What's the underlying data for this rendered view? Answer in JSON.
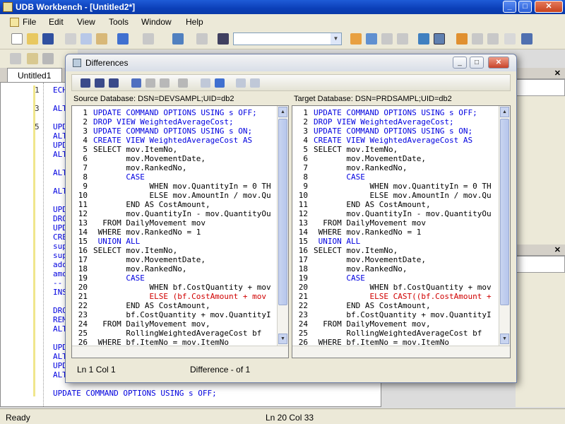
{
  "window": {
    "title": "UDB Workbench - [Untitled2*]"
  },
  "menu": [
    "File",
    "Edit",
    "View",
    "Tools",
    "Window",
    "Help"
  ],
  "editor_tab": "Untitled1",
  "editor_lines": [
    {
      "num": "1",
      "text": "ECHO"
    },
    {
      "num": "",
      "text": ""
    },
    {
      "num": "3",
      "text": "ALTER"
    },
    {
      "num": "",
      "text": ""
    },
    {
      "num": "5",
      "text": "UPDA"
    },
    {
      "num": "",
      "text": "ALTE"
    },
    {
      "num": "",
      "text": "UPDA"
    },
    {
      "num": "",
      "text": "ALTE"
    },
    {
      "num": "",
      "text": ""
    },
    {
      "num": "",
      "text": "ALTE"
    },
    {
      "num": "",
      "text": ""
    },
    {
      "num": "",
      "text": "ALTE"
    },
    {
      "num": "",
      "text": ""
    },
    {
      "num": "",
      "text": "UPDA"
    },
    {
      "num": "",
      "text": "DROP"
    },
    {
      "num": "",
      "text": "UPDA"
    },
    {
      "num": "",
      "text": "CREA"
    },
    {
      "num": "",
      "text": "supe"
    },
    {
      "num": "",
      "text": "supe"
    },
    {
      "num": "",
      "text": "adde"
    },
    {
      "num": "",
      "text": "amou"
    },
    {
      "num": "",
      "text": "--"
    },
    {
      "num": "",
      "text": "INSE"
    },
    {
      "num": "",
      "text": ""
    },
    {
      "num": "",
      "text": "DROP"
    },
    {
      "num": "",
      "text": "REMO"
    },
    {
      "num": "",
      "text": "ALTE"
    },
    {
      "num": "",
      "text": ""
    },
    {
      "num": "",
      "text": "UPDA"
    },
    {
      "num": "",
      "text": "ALTE"
    },
    {
      "num": "",
      "text": "UPDA"
    },
    {
      "num": "",
      "text": "ALTE"
    },
    {
      "num": "",
      "text": ""
    },
    {
      "num": "",
      "text": "UPDATE COMMAND OPTIONS USING s OFF;"
    }
  ],
  "status": {
    "left": "Ready",
    "position": "Ln 20  Col 33"
  },
  "dialog": {
    "title": "Differences",
    "source_header": "Source Database: DSN=DEVSAMPL;UID=db2",
    "target_header": "Target Database: DSN=PRDSAMPL;UID=db2",
    "status_pos": "Ln 1  Col 1",
    "status_diff": "Difference - of 1",
    "source_lines": [
      {
        "n": "1",
        "t": "UPDATE COMMAND OPTIONS USING s OFF;",
        "c": "kw"
      },
      {
        "n": "2",
        "t": "DROP VIEW WeightedAverageCost;",
        "c": "kw"
      },
      {
        "n": "3",
        "t": "UPDATE COMMAND OPTIONS USING s ON;",
        "c": "kw"
      },
      {
        "n": "4",
        "t": "CREATE VIEW WeightedAverageCost AS",
        "c": "kw"
      },
      {
        "n": "5",
        "t": "SELECT mov.ItemNo,",
        "c": ""
      },
      {
        "n": "6",
        "t": "       mov.MovementDate,",
        "c": ""
      },
      {
        "n": "7",
        "t": "       mov.RankedNo,",
        "c": ""
      },
      {
        "n": "8",
        "t": "       CASE",
        "c": "kw"
      },
      {
        "n": "9",
        "t": "            WHEN mov.QuantityIn = 0 TH",
        "c": ""
      },
      {
        "n": "10",
        "t": "            ELSE mov.AmountIn / mov.Qu",
        "c": ""
      },
      {
        "n": "11",
        "t": "       END AS CostAmount,",
        "c": ""
      },
      {
        "n": "12",
        "t": "       mov.QuantityIn - mov.QuantityOu",
        "c": ""
      },
      {
        "n": "13",
        "t": "  FROM DailyMovement mov",
        "c": ""
      },
      {
        "n": "14",
        "t": " WHERE mov.RankedNo = 1",
        "c": ""
      },
      {
        "n": "15",
        "t": " UNION ALL",
        "c": "kw"
      },
      {
        "n": "16",
        "t": "SELECT mov.ItemNo,",
        "c": ""
      },
      {
        "n": "17",
        "t": "       mov.MovementDate,",
        "c": ""
      },
      {
        "n": "18",
        "t": "       mov.RankedNo,",
        "c": ""
      },
      {
        "n": "19",
        "t": "       CASE",
        "c": "kw"
      },
      {
        "n": "20",
        "t": "            WHEN bf.CostQuantity + mov",
        "c": ""
      },
      {
        "n": "21",
        "t": "            ELSE (bf.CostAmount + mov",
        "c": "red"
      },
      {
        "n": "22",
        "t": "       END AS CostAmount,",
        "c": ""
      },
      {
        "n": "23",
        "t": "       bf.CostQuantity + mov.QuantityI",
        "c": ""
      },
      {
        "n": "24",
        "t": "  FROM DailyMovement mov,",
        "c": ""
      },
      {
        "n": "25",
        "t": "       RollingWeightedAverageCost bf",
        "c": ""
      },
      {
        "n": "26",
        "t": " WHERE bf.ItemNo = mov.ItemNo",
        "c": ""
      }
    ],
    "target_lines": [
      {
        "n": "1",
        "t": "UPDATE COMMAND OPTIONS USING s OFF;",
        "c": "kw"
      },
      {
        "n": "2",
        "t": "DROP VIEW WeightedAverageCost;",
        "c": "kw"
      },
      {
        "n": "3",
        "t": "UPDATE COMMAND OPTIONS USING s ON;",
        "c": "kw"
      },
      {
        "n": "4",
        "t": "CREATE VIEW WeightedAverageCost AS",
        "c": "kw"
      },
      {
        "n": "5",
        "t": "SELECT mov.ItemNo,",
        "c": ""
      },
      {
        "n": "6",
        "t": "       mov.MovementDate,",
        "c": ""
      },
      {
        "n": "7",
        "t": "       mov.RankedNo,",
        "c": ""
      },
      {
        "n": "8",
        "t": "       CASE",
        "c": "kw"
      },
      {
        "n": "9",
        "t": "            WHEN mov.QuantityIn = 0 TH",
        "c": ""
      },
      {
        "n": "10",
        "t": "            ELSE mov.AmountIn / mov.Qu",
        "c": ""
      },
      {
        "n": "11",
        "t": "       END AS CostAmount,",
        "c": ""
      },
      {
        "n": "12",
        "t": "       mov.QuantityIn - mov.QuantityOu",
        "c": ""
      },
      {
        "n": "13",
        "t": "  FROM DailyMovement mov",
        "c": ""
      },
      {
        "n": "14",
        "t": " WHERE mov.RankedNo = 1",
        "c": ""
      },
      {
        "n": "15",
        "t": " UNION ALL",
        "c": "kw"
      },
      {
        "n": "16",
        "t": "SELECT mov.ItemNo,",
        "c": ""
      },
      {
        "n": "17",
        "t": "       mov.MovementDate,",
        "c": ""
      },
      {
        "n": "18",
        "t": "       mov.RankedNo,",
        "c": ""
      },
      {
        "n": "19",
        "t": "       CASE",
        "c": "kw"
      },
      {
        "n": "20",
        "t": "            WHEN bf.CostQuantity + mov",
        "c": ""
      },
      {
        "n": "21",
        "t": "            ELSE CAST((bf.CostAmount +",
        "c": "red"
      },
      {
        "n": "22",
        "t": "       END AS CostAmount,",
        "c": ""
      },
      {
        "n": "23",
        "t": "       bf.CostQuantity + mov.QuantityI",
        "c": ""
      },
      {
        "n": "24",
        "t": "  FROM DailyMovement mov,",
        "c": ""
      },
      {
        "n": "25",
        "t": "       RollingWeightedAverageCost bf",
        "c": ""
      },
      {
        "n": "26",
        "t": " WHERE bf.ItemNo = mov.ItemNo",
        "c": ""
      }
    ]
  },
  "colors": {
    "keyword": "#0000e0",
    "diff": "#d00000",
    "titlebar": "#0b3fb8"
  }
}
